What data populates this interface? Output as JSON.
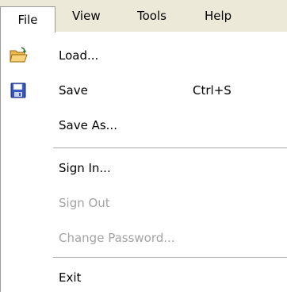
{
  "menubar": {
    "items": [
      {
        "label": "File"
      },
      {
        "label": "View"
      },
      {
        "label": "Tools"
      },
      {
        "label": "Help"
      }
    ]
  },
  "file_menu": {
    "items": [
      {
        "label": "Load...",
        "icon": "open-folder-icon",
        "enabled": true
      },
      {
        "label": "Save",
        "shortcut": "Ctrl+S",
        "icon": "floppy-disk-icon",
        "enabled": true
      },
      {
        "label": "Save As...",
        "enabled": true
      },
      {
        "label": "Sign In...",
        "enabled": true
      },
      {
        "label": "Sign Out",
        "enabled": false
      },
      {
        "label": "Change Password...",
        "enabled": false
      },
      {
        "label": "Exit",
        "enabled": true
      }
    ]
  },
  "colors": {
    "menubar_bg": "#ece9d8",
    "disabled_text": "#a3a3a3",
    "border": "#9a9a9a"
  }
}
